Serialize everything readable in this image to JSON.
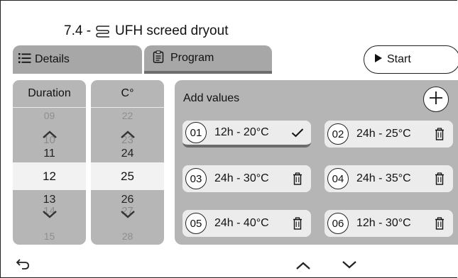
{
  "header": {
    "title_prefix": "7.4 -",
    "title_text": "UFH screed dryout",
    "title_icon": "floor-heating-icon"
  },
  "tabs": [
    {
      "label": "Details",
      "icon": "list-icon",
      "selected": false
    },
    {
      "label": "Program",
      "icon": "clipboard-icon",
      "selected": true
    }
  ],
  "start_button": {
    "label": "Start",
    "icon": "play-icon"
  },
  "duration_wheel": {
    "header": "Duration",
    "values": [
      "09",
      "10",
      "11",
      "12",
      "13",
      "14",
      "15"
    ],
    "selected": "12"
  },
  "temperature_wheel": {
    "header": "C°",
    "values": [
      "22",
      "23",
      "24",
      "25",
      "26",
      "27",
      "28"
    ],
    "selected": "25"
  },
  "program": {
    "title": "Add values",
    "add_icon": "plus-icon",
    "entries": [
      {
        "num": "01",
        "value": "12h - 20°C",
        "action_icon": "check-icon",
        "selected": true
      },
      {
        "num": "02",
        "value": "24h - 25°C",
        "action_icon": "trash-icon",
        "selected": false
      },
      {
        "num": "03",
        "value": "24h - 30°C",
        "action_icon": "trash-icon",
        "selected": false
      },
      {
        "num": "04",
        "value": "24h - 35°C",
        "action_icon": "trash-icon",
        "selected": false
      },
      {
        "num": "05",
        "value": "24h - 40°C",
        "action_icon": "trash-icon",
        "selected": false
      },
      {
        "num": "06",
        "value": "12h - 30°C",
        "action_icon": "trash-icon",
        "selected": false
      }
    ]
  },
  "footer": {
    "back_icon": "back-arrow-icon",
    "up_icon": "chevron-up-icon",
    "down_icon": "chevron-down-icon"
  }
}
